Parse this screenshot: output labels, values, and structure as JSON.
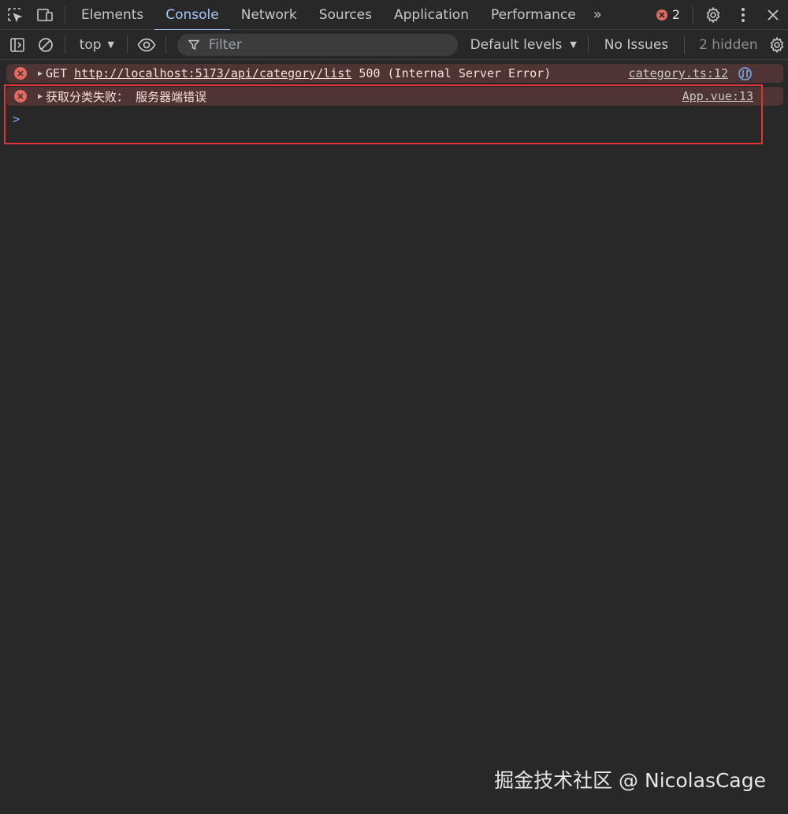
{
  "tabbar": {
    "tabs": [
      {
        "label": "Elements",
        "active": false
      },
      {
        "label": "Console",
        "active": true
      },
      {
        "label": "Network",
        "active": false
      },
      {
        "label": "Sources",
        "active": false
      },
      {
        "label": "Application",
        "active": false
      },
      {
        "label": "Performance",
        "active": false
      }
    ],
    "more_label": "»",
    "error_count": "2",
    "icons": [
      "inspect-element-icon",
      "device-toolbar-icon",
      "gear-icon",
      "kebab-menu-icon",
      "close-icon"
    ]
  },
  "toolbar": {
    "context": "top",
    "filter_placeholder": "Filter",
    "levels": "Default levels",
    "issues": "No Issues",
    "hidden": "2 hidden"
  },
  "messages": [
    {
      "prefix": "GET ",
      "url": "http://localhost:5173/api/category/list",
      "suffix": " 500 (Internal Server Error)",
      "source": "category.ts:12"
    },
    {
      "text": "获取分类失败： 服务器端错误",
      "source": "App.vue:13"
    }
  ],
  "prompt": ">",
  "watermark": "掘金技术社区 @ NicolasCage",
  "colors": {
    "background": "#282828",
    "accent": "#a8c7fa",
    "error_bg": "#4e3534",
    "error_icon": "#e46962",
    "highlight": "#e0323a"
  }
}
